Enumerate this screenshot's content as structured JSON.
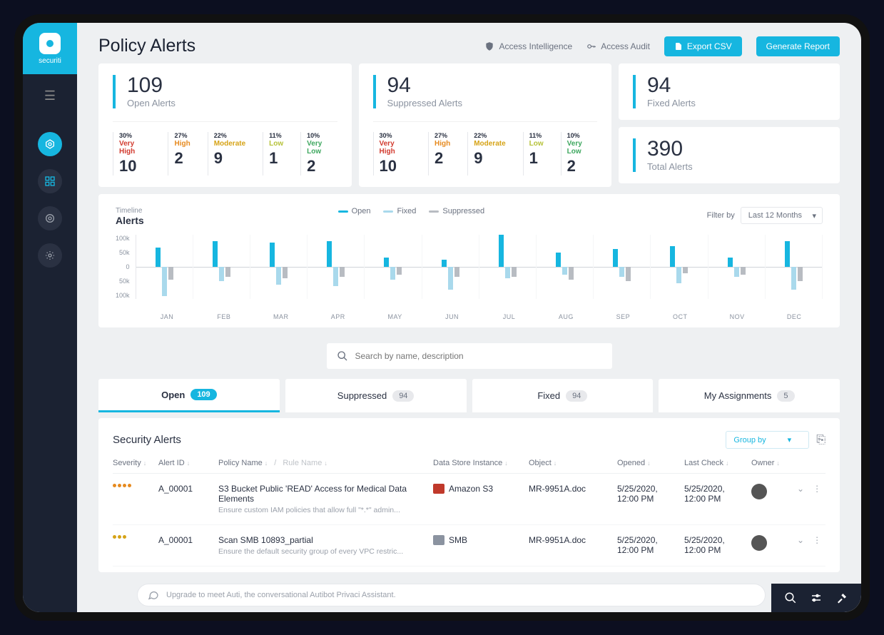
{
  "brand": "securiti",
  "page_title": "Policy Alerts",
  "header_links": {
    "access_intelligence": "Access Intelligence",
    "access_audit": "Access Audit"
  },
  "buttons": {
    "export_csv": "Export CSV",
    "generate_report": "Generate Report"
  },
  "summary": {
    "open": {
      "value": "109",
      "label": "Open Alerts"
    },
    "suppressed": {
      "value": "94",
      "label": "Suppressed Alerts"
    },
    "fixed": {
      "value": "94",
      "label": "Fixed Alerts"
    },
    "total": {
      "value": "390",
      "label": "Total Alerts"
    }
  },
  "severity_colors": {
    "very_high": "#d23b2f",
    "high": "#e68a1f",
    "moderate": "#d6a316",
    "low": "#b6c23a",
    "very_low": "#3fa860"
  },
  "open_sev": [
    {
      "pct": "30%",
      "label": "Very High",
      "num": "10",
      "color": "#d23b2f"
    },
    {
      "pct": "27%",
      "label": "High",
      "num": "2",
      "color": "#e68a1f"
    },
    {
      "pct": "22%",
      "label": "Moderate",
      "num": "9",
      "color": "#d6a316"
    },
    {
      "pct": "11%",
      "label": "Low",
      "num": "1",
      "color": "#b6c23a"
    },
    {
      "pct": "10%",
      "label": "Very Low",
      "num": "2",
      "color": "#3fa860"
    }
  ],
  "supp_sev": [
    {
      "pct": "30%",
      "label": "Very High",
      "num": "10",
      "color": "#d23b2f"
    },
    {
      "pct": "27%",
      "label": "High",
      "num": "2",
      "color": "#e68a1f"
    },
    {
      "pct": "22%",
      "label": "Moderate",
      "num": "9",
      "color": "#d6a316"
    },
    {
      "pct": "11%",
      "label": "Low",
      "num": "1",
      "color": "#b6c23a"
    },
    {
      "pct": "10%",
      "label": "Very Low",
      "num": "2",
      "color": "#3fa860"
    }
  ],
  "chart": {
    "overline": "Timeline",
    "title": "Alerts",
    "legend": {
      "open": "Open",
      "fixed": "Fixed",
      "suppressed": "Suppressed"
    },
    "filter_label": "Filter by",
    "filter_value": "Last 12 Months",
    "ylabels": [
      "100k",
      "50k",
      "0",
      "50k",
      "100k"
    ]
  },
  "chart_data": {
    "type": "bar",
    "categories": [
      "JAN",
      "FEB",
      "MAR",
      "APR",
      "MAY",
      "JUN",
      "JUL",
      "AUG",
      "SEP",
      "OCT",
      "NOV",
      "DEC"
    ],
    "ylim": [
      -100000,
      100000
    ],
    "series": [
      {
        "name": "Open",
        "color": "#16b6e0",
        "values": [
          60000,
          80000,
          75000,
          80000,
          30000,
          22000,
          100000,
          45000,
          55000,
          65000,
          30000,
          80000
        ]
      },
      {
        "name": "Fixed",
        "color": "#a9d9ec",
        "values": [
          -90000,
          -45000,
          -55000,
          -60000,
          -40000,
          -70000,
          -35000,
          -25000,
          -30000,
          -50000,
          -32000,
          -70000
        ]
      },
      {
        "name": "Suppressed",
        "color": "#b8bcc2",
        "values": [
          -40000,
          -30000,
          -35000,
          -30000,
          -25000,
          -30000,
          -30000,
          -40000,
          -45000,
          -20000,
          -25000,
          -45000
        ]
      }
    ]
  },
  "search": {
    "placeholder": "Search by name, description"
  },
  "tabs": {
    "open": {
      "label": "Open",
      "count": "109"
    },
    "suppressed": {
      "label": "Suppressed",
      "count": "94"
    },
    "fixed": {
      "label": "Fixed",
      "count": "94"
    },
    "mine": {
      "label": "My Assignments",
      "count": "5"
    }
  },
  "table": {
    "title": "Security Alerts",
    "group_by": "Group by",
    "columns": {
      "severity": "Severity",
      "alert_id": "Alert ID",
      "policy": "Policy Name",
      "rule": "Rule Name",
      "ds": "Data Store Instance",
      "object": "Object",
      "opened": "Opened",
      "last_check": "Last Check",
      "owner": "Owner"
    },
    "rows": [
      {
        "sev_dots": 4,
        "sev_color": "#e68a1f",
        "id": "A_00001",
        "policy": "S3 Bucket Public 'READ' Access for Medical Data Elements",
        "policy_sub": "Ensure custom IAM policies that allow full \"*.*\" admin...",
        "ds": "Amazon S3",
        "ds_color": "#c0392b",
        "object": "MR-9951A.doc",
        "opened": "5/25/2020, 12:00 PM",
        "last_check": "5/25/2020, 12:00 PM"
      },
      {
        "sev_dots": 3,
        "sev_color": "#d6a316",
        "id": "A_00001",
        "policy": "Scan SMB 10893_partial",
        "policy_sub": "Ensure the default security group of every VPC restric...",
        "ds": "SMB",
        "ds_color": "#8b93a0",
        "object": "MR-9951A.doc",
        "opened": "5/25/2020, 12:00 PM",
        "last_check": "5/25/2020, 12:00 PM"
      }
    ]
  },
  "footer": {
    "auti": "Upgrade to meet Auti, the conversational Autibot Privaci Assistant."
  }
}
